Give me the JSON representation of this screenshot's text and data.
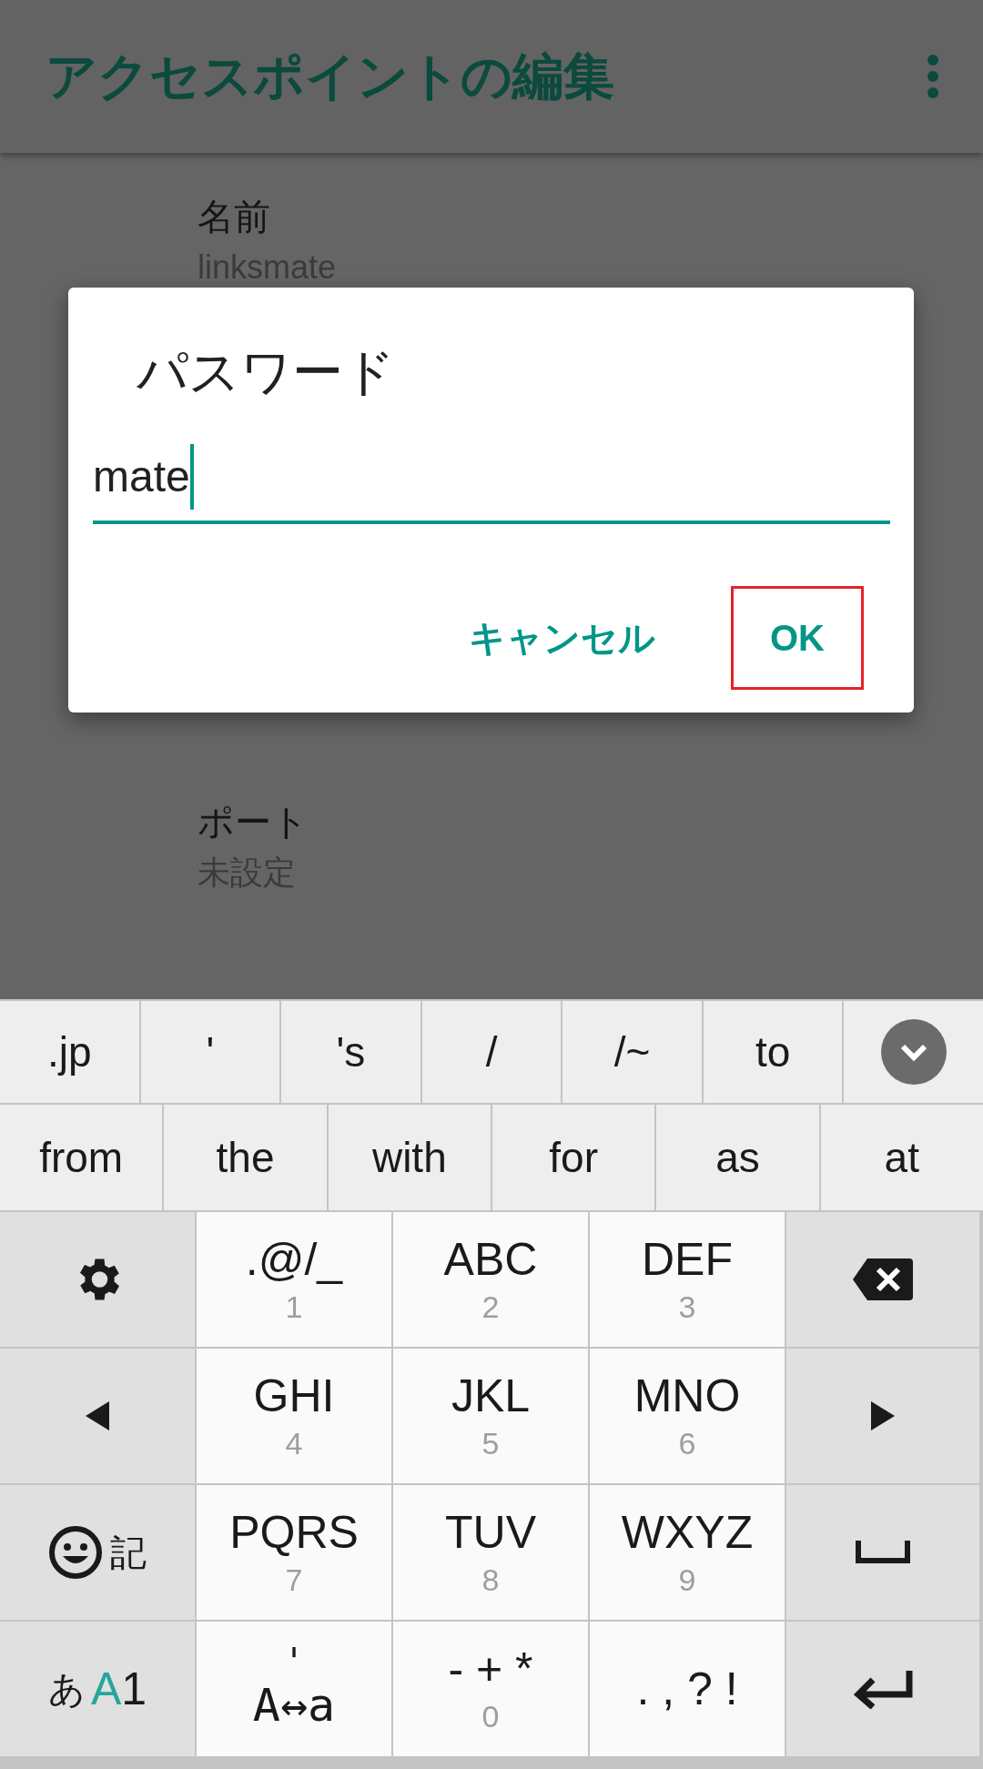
{
  "app_bar": {
    "title": "アクセスポイントの編集"
  },
  "settings": [
    {
      "label": "名前",
      "value": "linksmate"
    },
    {
      "label": "ポート",
      "value": "未設定"
    }
  ],
  "dialog": {
    "title": "パスワード",
    "field": {
      "value": "mate",
      "focused": true
    },
    "buttons": [
      {
        "label": "キャンセル",
        "highlighted": false
      },
      {
        "label": "OK",
        "highlighted": true
      }
    ]
  },
  "keyboard": {
    "suggestions": [
      ".jp",
      "'",
      "'s",
      "/",
      "/~",
      "to"
    ],
    "suggestions_2": [
      "from",
      "the",
      "with",
      "for",
      "as",
      "at"
    ],
    "keys": [
      {
        "kind": "settings"
      },
      {
        "kind": "letters",
        "label": ".@/_",
        "number": "1"
      },
      {
        "kind": "letters",
        "label": "ABC",
        "number": "2"
      },
      {
        "kind": "letters",
        "label": "DEF",
        "number": "3"
      },
      {
        "kind": "backspace"
      },
      {
        "kind": "left"
      },
      {
        "kind": "letters",
        "label": "GHI",
        "number": "4"
      },
      {
        "kind": "letters",
        "label": "JKL",
        "number": "5"
      },
      {
        "kind": "letters",
        "label": "MNO",
        "number": "6"
      },
      {
        "kind": "right"
      },
      {
        "kind": "emoji",
        "label": "記"
      },
      {
        "kind": "letters",
        "label": "PQRS",
        "number": "7"
      },
      {
        "kind": "letters",
        "label": "TUV",
        "number": "8"
      },
      {
        "kind": "letters",
        "label": "WXYZ",
        "number": "9"
      },
      {
        "kind": "space"
      },
      {
        "kind": "mode",
        "modes": [
          {
            "label": "あ",
            "selected": false
          },
          {
            "label": "A",
            "selected": true
          },
          {
            "label": "1",
            "selected": false
          }
        ]
      },
      {
        "kind": "case",
        "top": "'",
        "label": "A↔a"
      },
      {
        "kind": "letters",
        "label": "- + *",
        "number": "0"
      },
      {
        "kind": "symbols",
        "label": ". , ? !"
      },
      {
        "kind": "enter"
      }
    ]
  }
}
